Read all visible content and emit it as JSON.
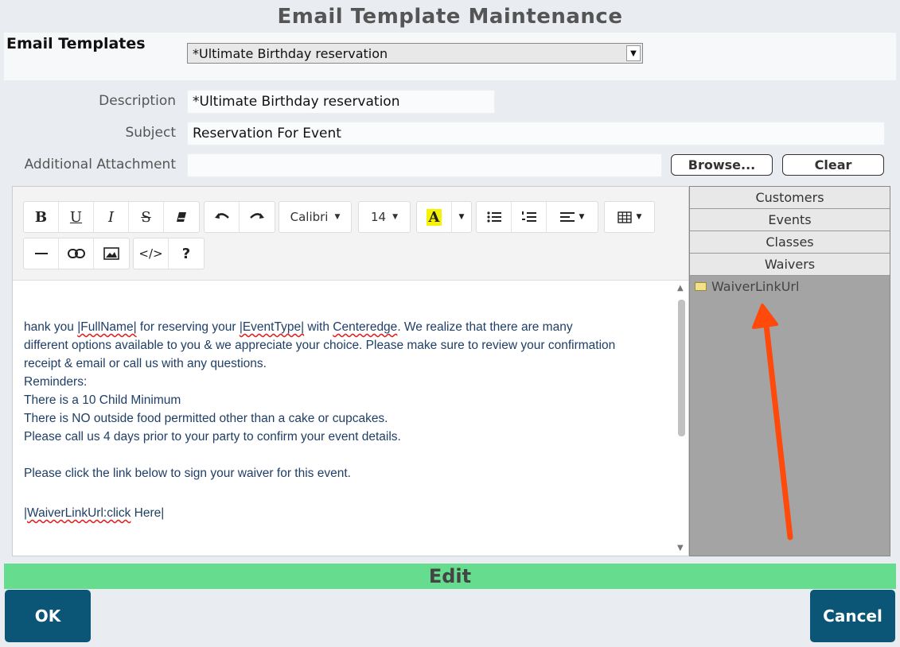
{
  "window": {
    "title": "Email Template Maintenance"
  },
  "templates": {
    "label": "Email Templates",
    "selected": "*Ultimate Birthday reservation"
  },
  "form": {
    "description_label": "Description",
    "description_value": "*Ultimate Birthday reservation",
    "subject_label": "Subject",
    "subject_value": "Reservation For Event",
    "attachment_label": "Additional Attachment",
    "attachment_value": "",
    "browse_label": "Browse...",
    "clear_label": "Clear"
  },
  "toolbar": {
    "bold": "B",
    "underline": "U",
    "italic": "I",
    "strikethrough": "S",
    "font_name": "Calibri",
    "font_size": "14",
    "text_color_glyph": "A",
    "code_glyph": "</>",
    "help_glyph": "?"
  },
  "content": {
    "line1_a": "hank you ",
    "line1_full_name": "|FullName|",
    "line1_b": " for reserving your ",
    "line1_event_type": "|EventType|",
    "line1_c": " with ",
    "line1_centeredge": "Centeredge",
    "line1_d": ".  We realize that there are many",
    "line2": "different options available to you & we appreciate your choice.  Please make sure to review your confirmation",
    "line3": "receipt & email or call us with any questions.",
    "line4": "Reminders:",
    "line5": "There is a 10 Child Minimum",
    "line6": "There is NO outside food permitted other than a cake or cupcakes.",
    "line7": "Please call us 4 days prior to your party to confirm your event details.",
    "line8": "Please click the link below to sign your waiver for this event.",
    "line9_bar_open": "|",
    "line9_link": "WaiverLinkUrl:click",
    "line9_rest": " Here",
    "line9_bar_close": "|"
  },
  "panel": {
    "tabs": [
      "Customers",
      "Events",
      "Classes",
      "Waivers"
    ],
    "item": "WaiverLinkUrl"
  },
  "status": {
    "mode": "Edit"
  },
  "actions": {
    "ok": "OK",
    "cancel": "Cancel"
  },
  "colors": {
    "accent_arrow": "#ff4a0c",
    "button_bg": "#0b5577",
    "edit_bar": "#66dd8e"
  }
}
